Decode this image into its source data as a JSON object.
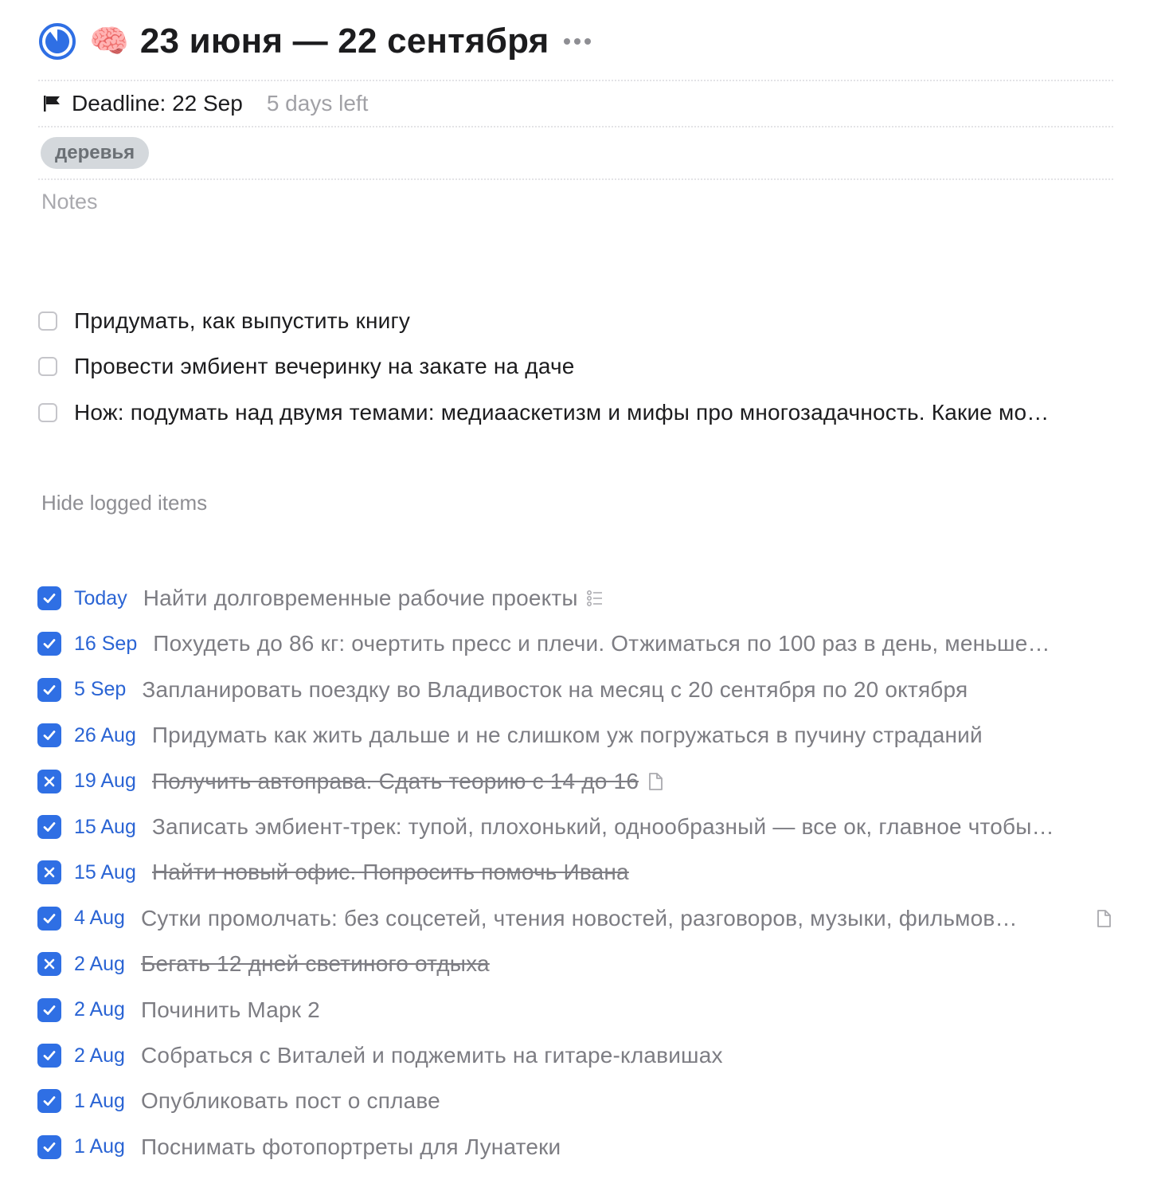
{
  "header": {
    "emoji": "🧠",
    "title": "23 июня — 22 сентября",
    "progress_fraction": 0.9
  },
  "deadline": {
    "label": "Deadline: 22 Sep",
    "remaining": "5 days left"
  },
  "tag": {
    "label": "деревья"
  },
  "notes": {
    "placeholder": "Notes"
  },
  "todos": [
    {
      "text": "Придумать, как выпустить книгу"
    },
    {
      "text": "Провести эмбиент вечеринку на закате на даче"
    },
    {
      "text": "Нож: подумать над двумя темами: медиааскетизм и мифы про многозадачность. Какие мо…"
    }
  ],
  "hide_logged_label": "Hide logged items",
  "logged": [
    {
      "date": "Today",
      "text": "Найти долговременные рабочие проекты",
      "status": "done",
      "icon": "checklist-icon"
    },
    {
      "date": "16 Sep",
      "text": "Похудеть до 86 кг: очертить пресс и плечи. Отжиматься по 100 раз в день, меньше…",
      "status": "done"
    },
    {
      "date": "5 Sep",
      "text": "Запланировать поездку во Владивосток на месяц с 20 сентября по 20 октября",
      "status": "done"
    },
    {
      "date": "26 Aug",
      "text": "Придумать как жить дальше и не слишком уж погружаться в пучину страданий",
      "status": "done"
    },
    {
      "date": "19 Aug",
      "text": "Получить автоправа. Сдать теорию с 14 до 16",
      "status": "canceled",
      "icon": "note-icon"
    },
    {
      "date": "15 Aug",
      "text": "Записать эмбиент-трек: тупой, плохонький, однообразный — все ок, главное чтобы…",
      "status": "done"
    },
    {
      "date": "15 Aug",
      "text": "Найти новый офис. Попросить помочь Ивана",
      "status": "canceled"
    },
    {
      "date": "4 Aug",
      "text": "Сутки промолчать: без соцсетей, чтения новостей, разговоров, музыки, фильмов…",
      "status": "done",
      "icon": "note-icon",
      "icon_right": true
    },
    {
      "date": "2 Aug",
      "text": "Бегать 12 дней светиного отдыха",
      "status": "canceled"
    },
    {
      "date": "2 Aug",
      "text": "Починить Марк 2",
      "status": "done"
    },
    {
      "date": "2 Aug",
      "text": "Собраться с Виталей и поджемить на гитаре-клавишах",
      "status": "done"
    },
    {
      "date": "1 Aug",
      "text": "Опубликовать пост о сплаве",
      "status": "done"
    },
    {
      "date": "1 Aug",
      "text": "Поснимать фотопортреты для Лунатеки",
      "status": "done"
    }
  ],
  "colors": {
    "accent": "#2f6fe4",
    "date_text": "#2a64d4",
    "logged_text": "#7d7d83",
    "tag_bg": "#d4d8dc"
  }
}
